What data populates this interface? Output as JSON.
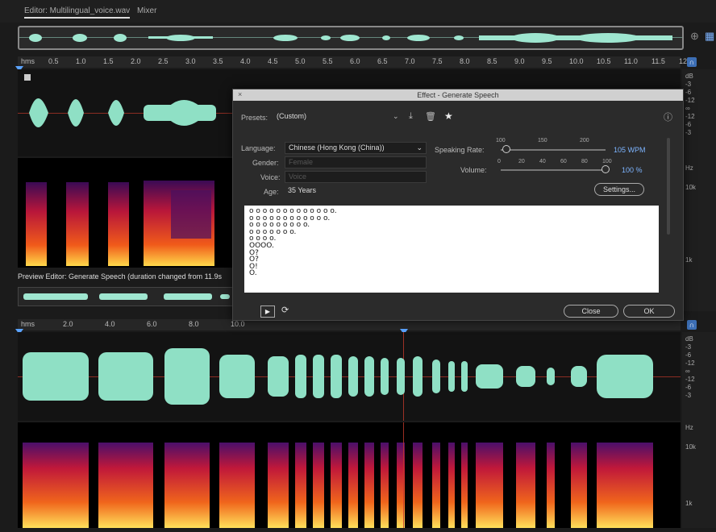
{
  "tabs": {
    "editor": "Editor: Multilingual_voice.wav",
    "mixer": "Mixer"
  },
  "top_ruler": {
    "labels": [
      "hms",
      "0.5",
      "1.0",
      "1.5",
      "2.0",
      "2.5",
      "3.0",
      "3.5",
      "4.0",
      "4.5",
      "5.0",
      "5.5",
      "6.0",
      "6.5",
      "7.0",
      "7.5",
      "8.0",
      "8.5",
      "9.0",
      "9.5",
      "10.0",
      "10.5",
      "11.0",
      "11.5",
      "12"
    ]
  },
  "bottom_ruler": {
    "labels": [
      "hms",
      "2.0",
      "4.0",
      "6.0",
      "8.0",
      "10.0"
    ]
  },
  "db_scale": {
    "top": [
      "dB",
      "-3",
      "-6",
      "-12",
      "∞",
      "-12",
      "-6",
      "-3"
    ],
    "bottom": [
      "dB",
      "-3",
      "-6",
      "-12",
      "∞",
      "-12",
      "-6",
      "-3"
    ],
    "hz_top": [
      "Hz",
      "10k",
      "1k"
    ],
    "hz_bottom": [
      "Hz",
      "10k",
      "1k"
    ]
  },
  "dialog": {
    "title": "Effect - Generate Speech",
    "presets_label": "Presets:",
    "presets_value": "(Custom)",
    "language_label": "Language:",
    "language_value": "Chinese (Hong Kong (China))",
    "gender_label": "Gender:",
    "gender_value": "Female",
    "voice_label": "Voice:",
    "voice_value": "Voice",
    "age_label": "Age:",
    "age_value": "35 Years",
    "speaking_rate_label": "Speaking Rate:",
    "speaking_rate_ticks": [
      "100",
      "150",
      "200"
    ],
    "speaking_rate_value": "105 WPM",
    "speaking_rate_level": 0.05,
    "volume_label": "Volume:",
    "volume_ticks": [
      "0",
      "20",
      "40",
      "60",
      "80",
      "100"
    ],
    "volume_value": "100 %",
    "volume_level": 1.0,
    "settings_button": "Settings...",
    "close_button": "Close",
    "ok_button": "OK",
    "text_lines": [
      "o o o o o o o o o o o o o.",
      "o o o o o o o o o o o o.",
      "o o o o o o o o o.",
      "o o o o o o o.",
      "o o o o.",
      "OOOO.",
      "O?",
      "O?",
      "O!",
      "O."
    ]
  },
  "preview_label": "Preview Editor: Generate Speech (duration changed from 11.9s",
  "colors": {
    "waveform": "#8fe0c5",
    "accent": "#5ba3ff"
  }
}
